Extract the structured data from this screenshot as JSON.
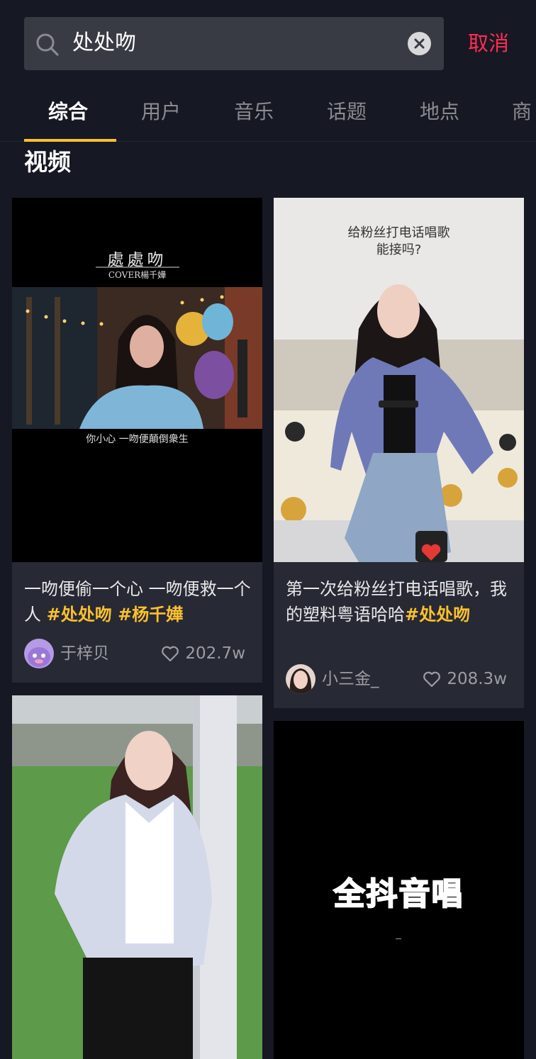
{
  "search": {
    "query": "处处吻",
    "cancel_label": "取消"
  },
  "tabs": [
    {
      "label": "综合"
    },
    {
      "label": "用户"
    },
    {
      "label": "音乐"
    },
    {
      "label": "话题"
    },
    {
      "label": "地点"
    },
    {
      "label": "商"
    }
  ],
  "section_title": "视频",
  "cards": [
    {
      "overlay_title": "處處吻",
      "overlay_subtitle": "COVER楊千嬅",
      "overlay_caption": "你小心 一吻便顛倒衆生",
      "desc_text": "一吻便偷一个心 一吻便救一个人 ",
      "hashtags": "#处处吻 #杨千嬅",
      "author": "于梓贝",
      "likes": "202.7w"
    },
    {
      "overlay_caption_line1": "给粉丝打电话唱歌",
      "overlay_caption_line2": "能接吗?",
      "desc_text": "第一次给粉丝打电话唱歌，我的塑料粤语哈哈",
      "hashtags": "#处处吻",
      "author": "小三金_",
      "likes": "208.3w"
    },
    {},
    {
      "overlay_caption": "全抖音唱"
    }
  ],
  "colors": {
    "accent": "#fbc02d",
    "cancel": "#fe2c55",
    "background": "#161823",
    "card": "#272934"
  }
}
